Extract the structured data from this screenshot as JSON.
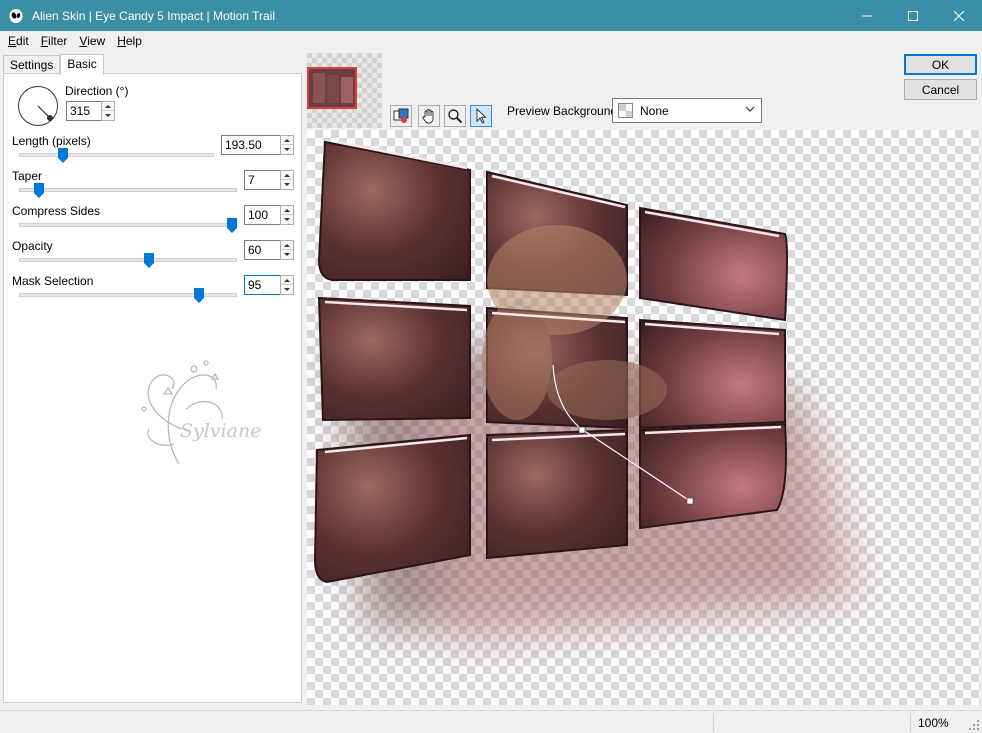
{
  "window": {
    "title": "Alien Skin | Eye Candy 5 Impact | Motion Trail",
    "title_bar_color": "#3a8fa6"
  },
  "menu": [
    {
      "label": "Edit",
      "accel": "E",
      "rest": "dit"
    },
    {
      "label": "Filter",
      "accel": "F",
      "rest": "ilter"
    },
    {
      "label": "View",
      "accel": "V",
      "rest": "iew"
    },
    {
      "label": "Help",
      "accel": "H",
      "rest": "elp"
    }
  ],
  "tabs": {
    "settings": "Settings",
    "basic": "Basic",
    "active": "Basic"
  },
  "controls": {
    "direction": {
      "label": "Direction (°)",
      "value": "315"
    },
    "length": {
      "label": "Length (pixels)",
      "value": "193.50",
      "slider_fraction": 0.21
    },
    "taper": {
      "label": "Taper",
      "value": "7",
      "slider_fraction": 0.07
    },
    "compress": {
      "label": "Compress Sides",
      "value": "100",
      "slider_fraction": 1.0
    },
    "opacity": {
      "label": "Opacity",
      "value": "60",
      "slider_fraction": 0.6
    },
    "mask": {
      "label": "Mask Selection",
      "value": "95",
      "slider_fraction": 0.84
    }
  },
  "watermark_text": "Sylviane",
  "toolbar": {
    "tools": [
      "preview-toggle-icon",
      "hand-icon",
      "zoom-icon",
      "pointer-icon"
    ],
    "active_tool": "pointer-icon"
  },
  "preview_background": {
    "label": "Preview Background:",
    "value": "None"
  },
  "buttons": {
    "ok": "OK",
    "cancel": "Cancel"
  },
  "status": {
    "zoom": "100%"
  },
  "colors": {
    "accent": "#0078d7",
    "tile": "#5a2f33",
    "tile_highlight": "#c97a82"
  }
}
